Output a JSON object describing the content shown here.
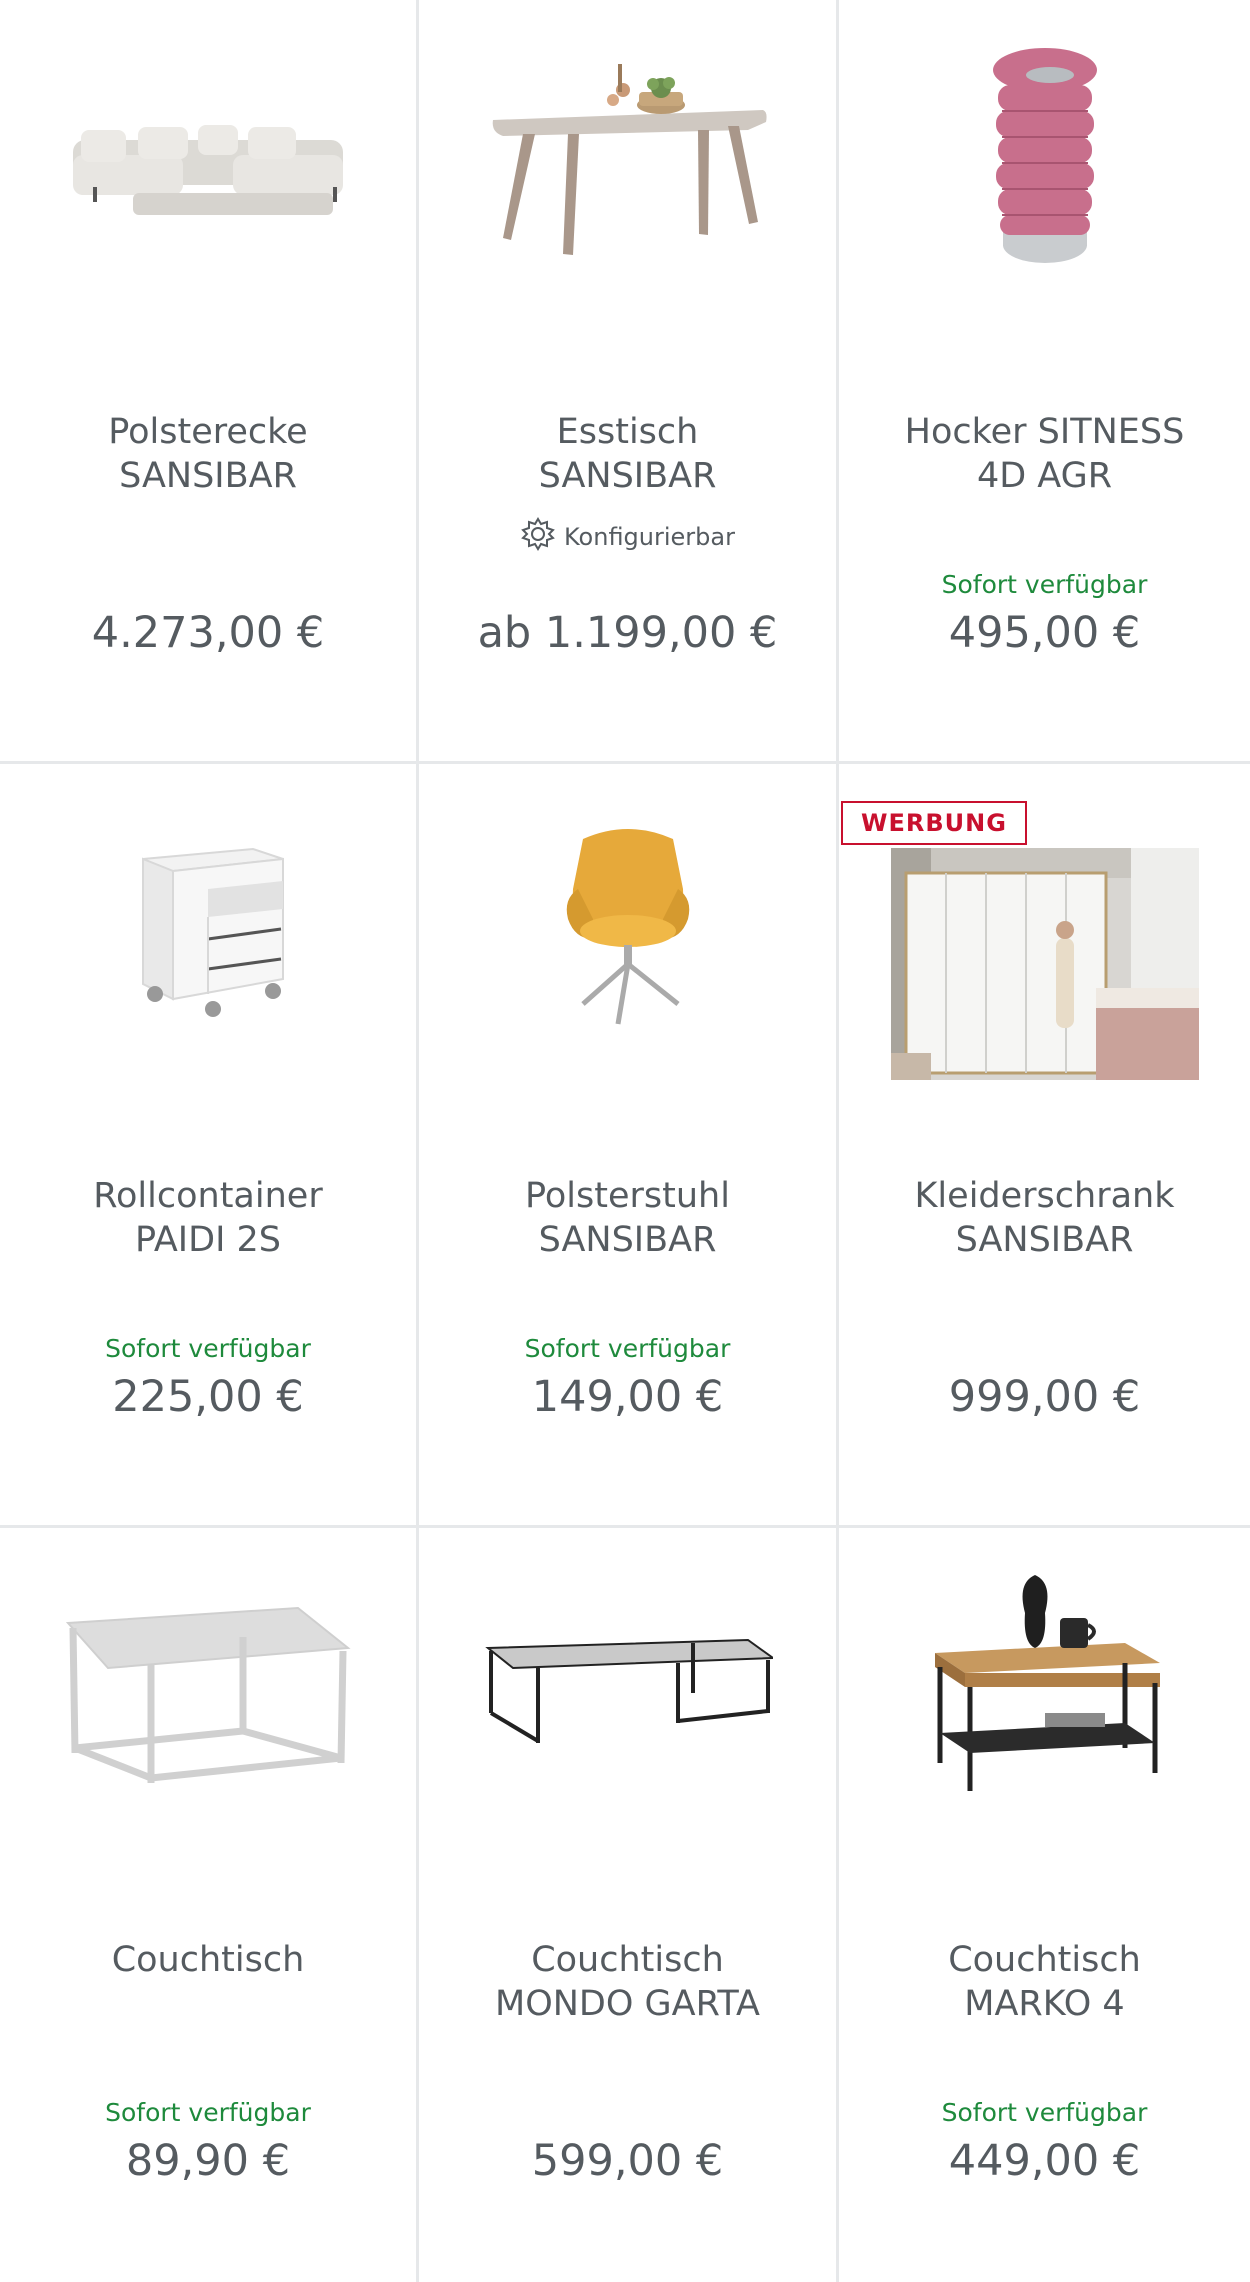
{
  "products": [
    {
      "title_line1": "Polsterecke",
      "title_line2": "SANSIBAR",
      "price": "4.273,00 €",
      "availability": "",
      "config": ""
    },
    {
      "title_line1": "Esstisch",
      "title_line2": "SANSIBAR",
      "price": "ab 1.199,00 €",
      "availability": "",
      "config": "Konfigurierbar"
    },
    {
      "title_line1": "Hocker SITNESS",
      "title_line2": "4D AGR",
      "price": "495,00 €",
      "availability": "Sofort verfügbar",
      "config": ""
    },
    {
      "title_line1": "Rollcontainer",
      "title_line2": "PAIDI 2S",
      "price": "225,00 €",
      "availability": "Sofort verfügbar",
      "config": ""
    },
    {
      "title_line1": "Polsterstuhl",
      "title_line2": "SANSIBAR",
      "price": "149,00 €",
      "availability": "Sofort verfügbar",
      "config": ""
    },
    {
      "title_line1": "Kleiderschrank",
      "title_line2": "SANSIBAR",
      "price": "999,00 €",
      "availability": "",
      "config": "",
      "badge": "WERBUNG"
    },
    {
      "title_line1": "Couchtisch",
      "title_line2": "",
      "price": "89,90 €",
      "availability": "Sofort verfügbar",
      "config": ""
    },
    {
      "title_line1": "Couchtisch",
      "title_line2": "MONDO GARTA",
      "price": "599,00 €",
      "availability": "",
      "config": ""
    },
    {
      "title_line1": "Couchtisch",
      "title_line2": "MARKO 4",
      "price": "449,00 €",
      "availability": "Sofort verfügbar",
      "config": ""
    }
  ],
  "colors": {
    "text": "#555b60",
    "available": "#1e8a3c",
    "badge": "#c8102e",
    "divider": "#e6e8ea"
  },
  "icons": {
    "config": "gear-icon"
  }
}
